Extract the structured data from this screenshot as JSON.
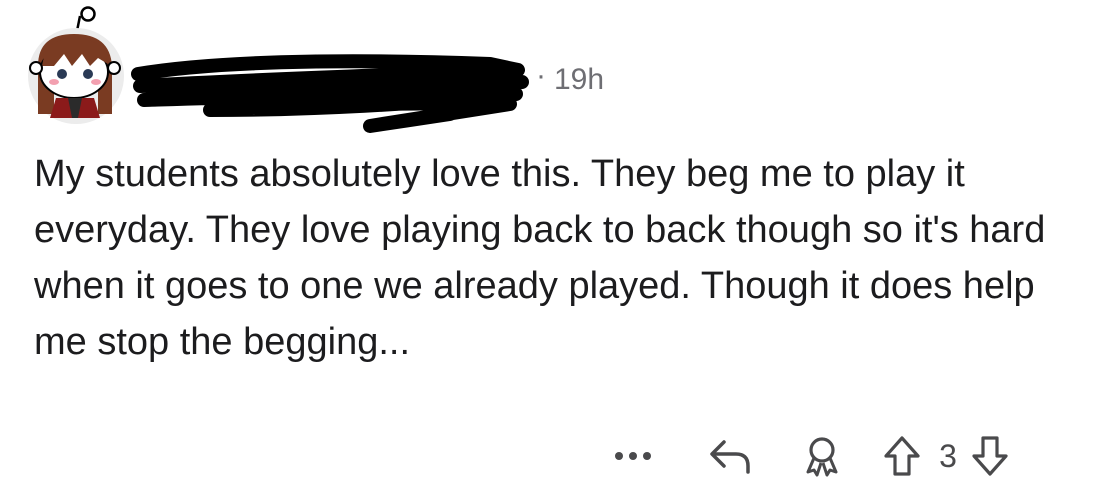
{
  "comment": {
    "author": "",
    "timestamp": "19h",
    "separator": "·",
    "body": "My students absolutely love this. They beg me to play it everyday. They love playing back to back though so it's hard when it goes to one we already played. Though it does help me stop the begging...",
    "score": "3"
  },
  "actions": {
    "more_glyph": "•••"
  },
  "icons": {
    "avatar": "snoo-avatar-icon",
    "more": "more-options-icon",
    "reply": "reply-arrow-icon",
    "award": "award-icon",
    "upvote": "upvote-arrow-icon",
    "downvote": "downvote-arrow-icon"
  },
  "colors": {
    "text": "#1c1c1e",
    "meta": "#6e6e73",
    "icon": "#4a4a4c"
  }
}
